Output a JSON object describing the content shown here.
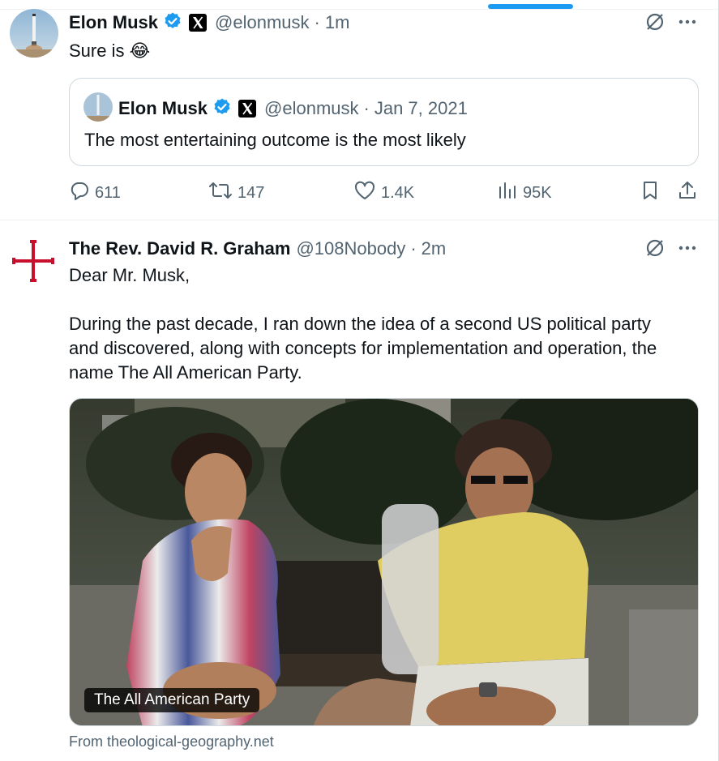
{
  "tweet1": {
    "author_name": "Elon Musk",
    "author_handle": "@elonmusk",
    "time": "1m",
    "text": "Sure is 😂",
    "quote": {
      "author_name": "Elon Musk",
      "author_handle": "@elonmusk",
      "date": "Jan 7, 2021",
      "text": "The most entertaining outcome is the most likely"
    },
    "actions": {
      "replies": "611",
      "reposts": "147",
      "likes": "1.4K",
      "views": "95K"
    }
  },
  "tweet2": {
    "author_name": "The Rev. David R. Graham",
    "author_handle": "@108Nobody",
    "time": "2m",
    "text_line1": "Dear Mr. Musk,",
    "text_line2": "During the past decade, I ran down the idea of a second US political party",
    "text_line3": "and discovered, along with concepts for implementation and operation, the",
    "text_line4": "name The All American Party.",
    "media_caption": "The All American Party",
    "link_source": "From theological-geography.net"
  },
  "colors": {
    "accent": "#1d9bf0",
    "secondary_text": "#536471",
    "verified": "#1d9bf0",
    "cross": "#c8102e"
  },
  "icons": [
    "verified-badge-icon",
    "x-logo-icon",
    "grok-icon",
    "more-icon",
    "reply-icon",
    "repost-icon",
    "like-icon",
    "views-icon",
    "bookmark-icon",
    "share-icon"
  ]
}
